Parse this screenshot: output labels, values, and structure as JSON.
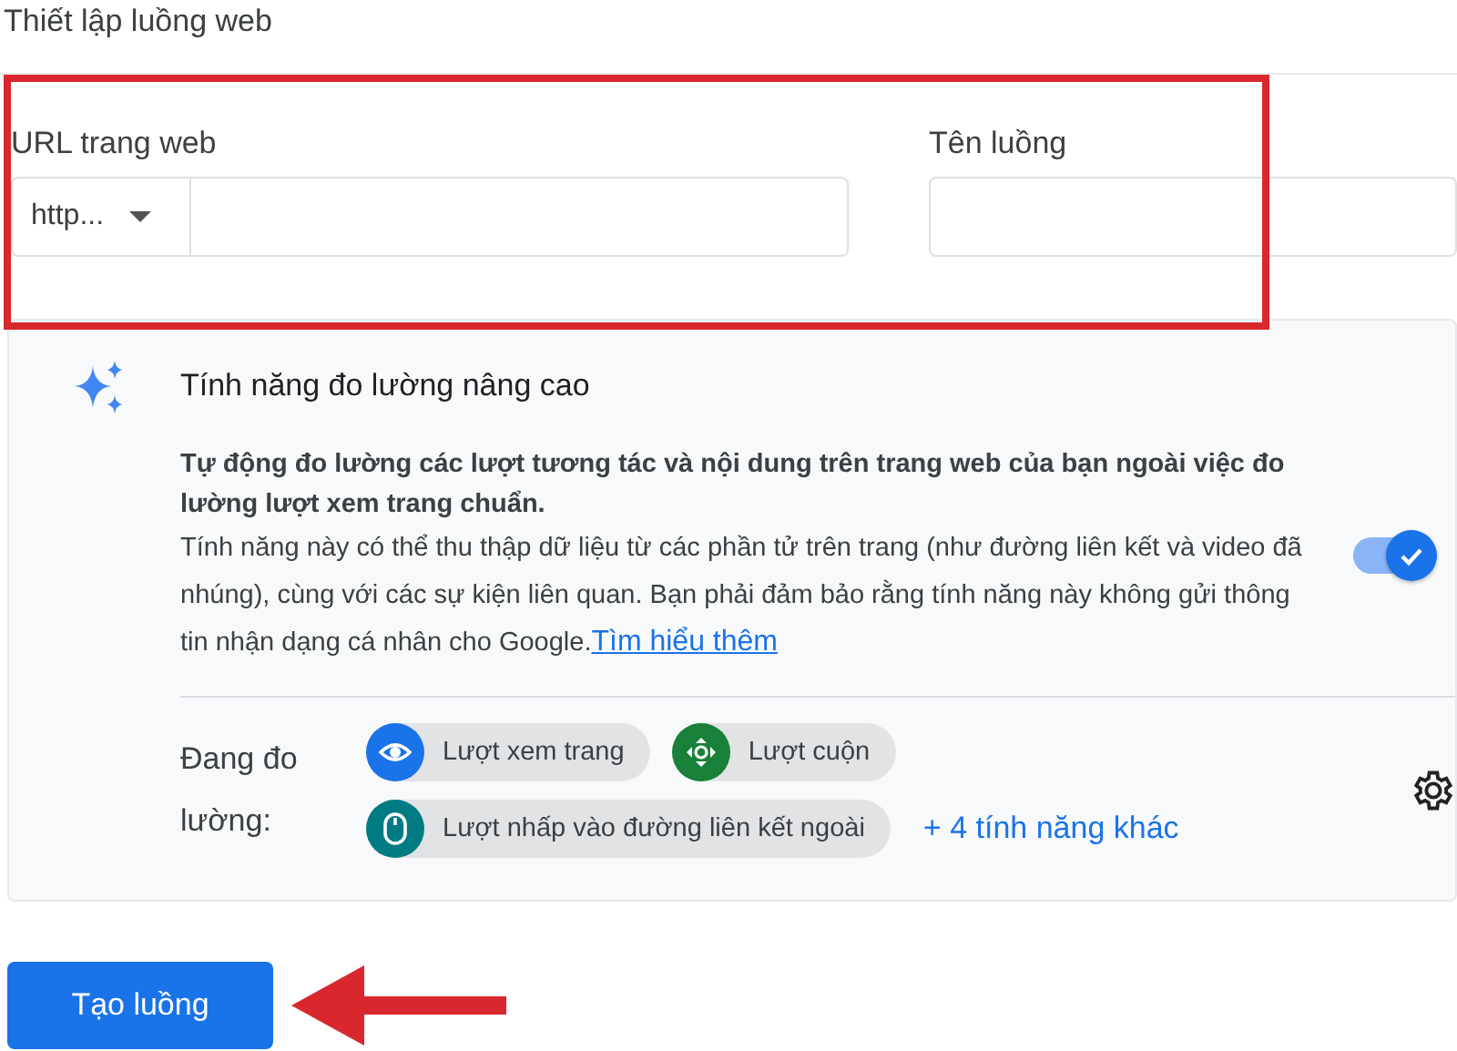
{
  "title": "Thiết lập luồng web",
  "url_field": {
    "label": "URL trang web",
    "protocol": "http..."
  },
  "name_field": {
    "label": "Tên luồng"
  },
  "enhanced": {
    "title": "Tính năng đo lường nâng cao",
    "lead": "Tự động đo lường các lượt tương tác và nội dung trên trang web của bạn ngoài việc đo lường lượt xem trang chuẩn.",
    "body": "Tính năng này có thể thu thập dữ liệu từ các phần tử trên trang (như đường liên kết và video đã nhúng), cùng với các sự kiện liên quan. Bạn phải đảm bảo rằng tính năng này không gửi thông tin nhận dạng cá nhân cho Google.",
    "link": "Tìm hiểu thêm",
    "on": true,
    "measuring_label": "Đang đo lường:",
    "chips": [
      {
        "kind": "eye",
        "label": "Lượt xem trang",
        "color": "#1a73e8"
      },
      {
        "kind": "scroll",
        "label": "Lượt cuộn",
        "color": "#188038"
      },
      {
        "kind": "mouse",
        "label": "Lượt nhấp vào đường liên kết ngoài",
        "color": "#007b83"
      }
    ],
    "more": "+ 4 tính năng khác"
  },
  "create_button": "Tạo luồng"
}
